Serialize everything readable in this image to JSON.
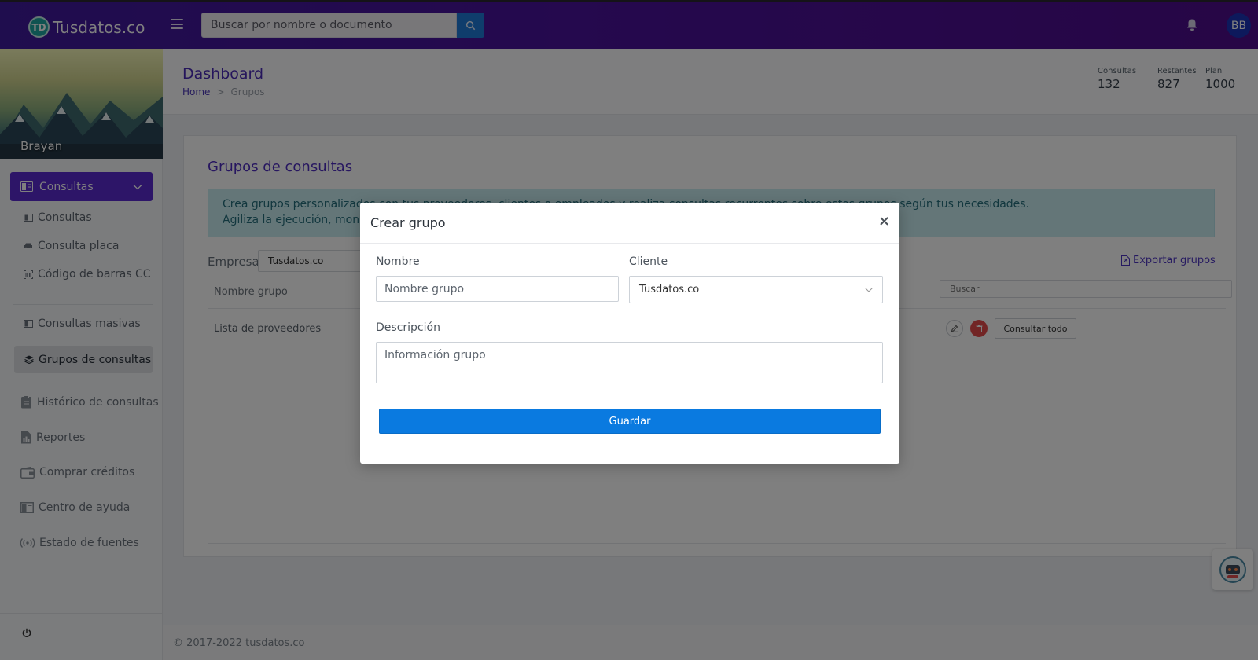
{
  "header": {
    "logo_badge": "TD",
    "logo_text": "Tusdatos.co",
    "search_placeholder": "Buscar por nombre o documento",
    "avatar_initials": "BB",
    "brand_color": "#4a129c"
  },
  "sidebar": {
    "user_name": "Brayan",
    "main_menu_label": "Consultas",
    "sub_items": [
      {
        "label": "Consultas",
        "icon": "card-icon"
      },
      {
        "label": "Consulta placa",
        "icon": "car-icon"
      },
      {
        "label": "Código de barras CC",
        "icon": "barcode-icon"
      }
    ],
    "group_items": [
      {
        "label": "Consultas masivas",
        "icon": "card-icon"
      },
      {
        "label": "Grupos de consultas",
        "icon": "layers-icon",
        "active": true
      }
    ],
    "items": [
      {
        "label": "Histórico de consultas",
        "icon": "clipboard-icon"
      },
      {
        "label": "Reportes",
        "icon": "report-icon"
      },
      {
        "label": "Comprar créditos",
        "icon": "wallet-icon"
      },
      {
        "label": "Centro de ayuda",
        "icon": "book-icon"
      },
      {
        "label": "Estado de fuentes",
        "icon": "broadcast-icon"
      }
    ]
  },
  "page": {
    "title": "Dashboard",
    "breadcrumb_home": "Home",
    "breadcrumb_sep": ">",
    "breadcrumb_current": "Grupos",
    "stats": [
      {
        "label": "Consultas",
        "value": "132"
      },
      {
        "label": "Restantes",
        "value": "827"
      },
      {
        "label": "Plan",
        "value": "1000"
      }
    ]
  },
  "card": {
    "title": "Grupos de consultas",
    "alert_line1": "Crea grupos personalizados con tus proveedores, clientes o empleados y realiza consultas recurrentes sobre estos grupos según tus necesidades.",
    "alert_line2": "Agiliza la ejecución, monitoreo y seguimiento de las consultas.",
    "empresa_label": "Empresa",
    "empresa_value": "Tusdatos.co",
    "export_label": "Exportar grupos",
    "col_name": "Nombre grupo",
    "search_placeholder": "Buscar",
    "rows": [
      {
        "name": "Lista de proveedores",
        "action_label": "Consultar todo"
      }
    ]
  },
  "footer": {
    "text": "© 2017-2022 tusdatos.co"
  },
  "modal": {
    "title": "Crear grupo",
    "close": "×",
    "nombre_label": "Nombre",
    "nombre_placeholder": "Nombre grupo",
    "cliente_label": "Cliente",
    "cliente_value": "Tusdatos.co",
    "descripcion_label": "Descripción",
    "descripcion_placeholder": "Información grupo",
    "save_label": "Guardar"
  }
}
